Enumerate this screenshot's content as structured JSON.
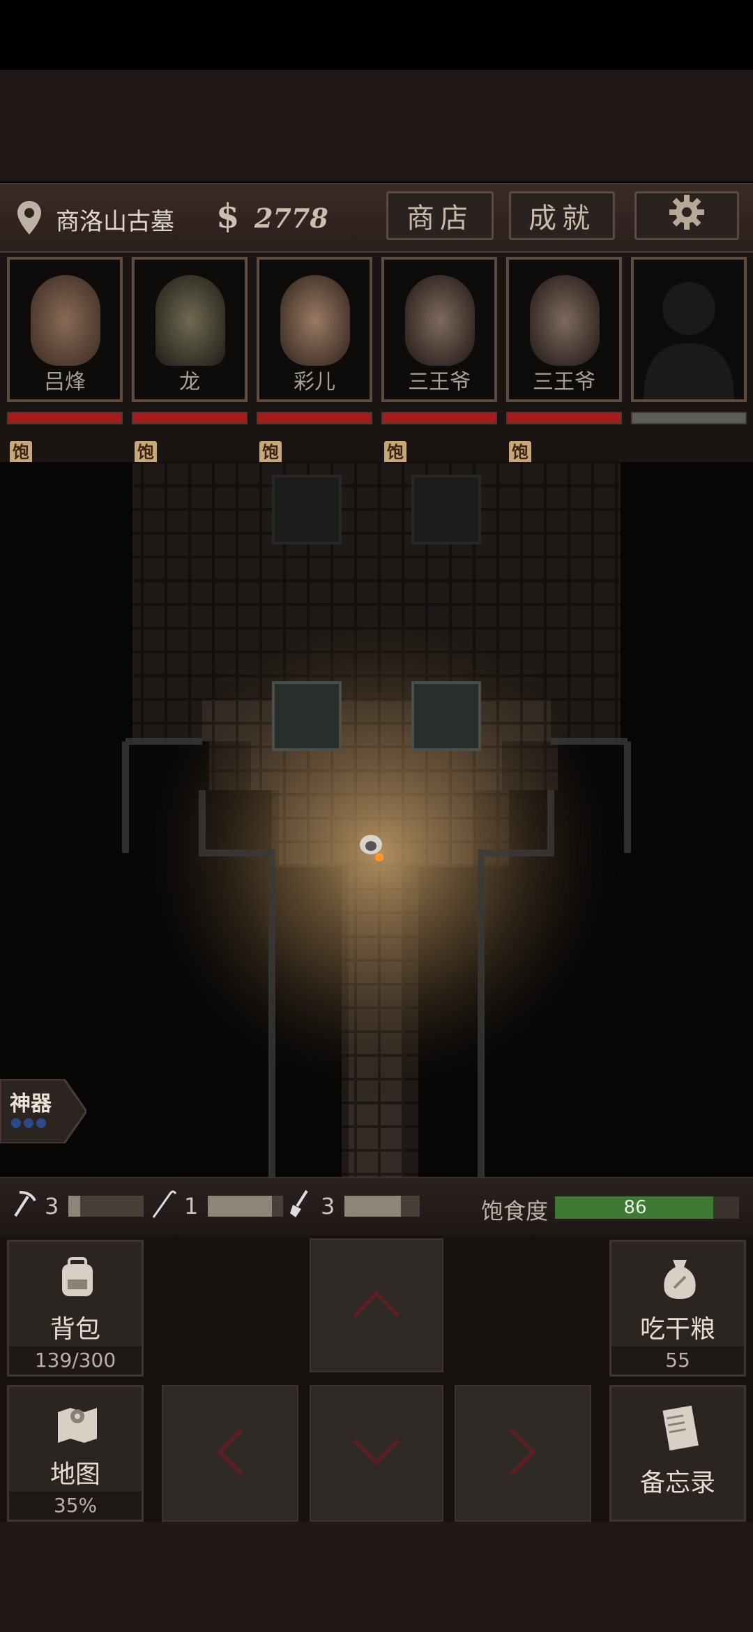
{
  "hud": {
    "location": "商洛山古墓",
    "currency_symbol": "$",
    "money": "2778",
    "shop_label": "商店",
    "achievements_label": "成就",
    "settings_icon": "gear-icon"
  },
  "party": [
    {
      "name": "吕烽",
      "status": "饱",
      "hp": 1.0
    },
    {
      "name": "龙",
      "status": "饱",
      "hp": 1.0
    },
    {
      "name": "彩儿",
      "status": "饱",
      "hp": 1.0
    },
    {
      "name": "三王爷",
      "status": "饱",
      "hp": 1.0
    },
    {
      "name": "三王爷",
      "status": "饱",
      "hp": 1.0
    },
    {
      "name": "",
      "status": "",
      "hp": 1.0
    }
  ],
  "artifact": {
    "label": "神器",
    "slots": 3
  },
  "tools": [
    {
      "icon": "pickaxe-icon",
      "count": "3",
      "durability": 0.15
    },
    {
      "icon": "hook-icon",
      "count": "1",
      "durability": 0.85
    },
    {
      "icon": "shovel-icon",
      "count": "3",
      "durability": 0.75
    }
  ],
  "satiety": {
    "label": "饱食度",
    "value": "86",
    "level": 0.86
  },
  "controls": {
    "backpack": {
      "label": "背包",
      "value": "139/300"
    },
    "eat": {
      "label": "吃干粮",
      "value": "55"
    },
    "map": {
      "label": "地图",
      "value": "35%"
    },
    "memo": {
      "label": "备忘录"
    }
  },
  "colors": {
    "hp": "#a51c1c",
    "satiety": "#3e7a34",
    "badge": "#c8a77a"
  }
}
